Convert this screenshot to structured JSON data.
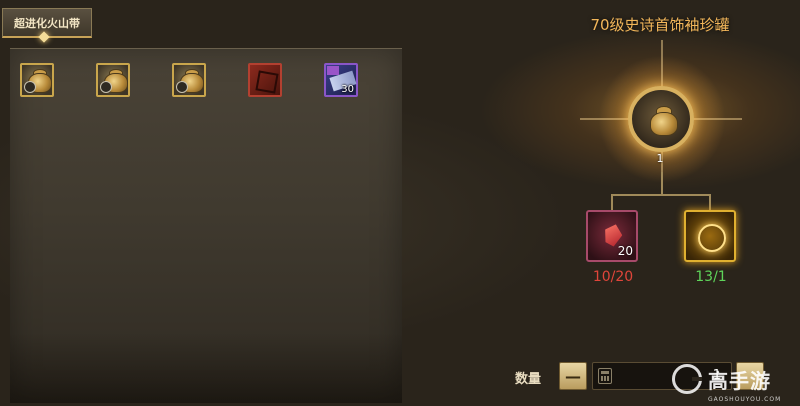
{
  "region": {
    "tab_label": "超进化火山带"
  },
  "inventory": {
    "items": [
      {
        "name": "珍罐",
        "rarity": "gold",
        "count": ""
      },
      {
        "name": "珍罐",
        "rarity": "gold",
        "count": ""
      },
      {
        "name": "珍罐",
        "rarity": "gold",
        "count": ""
      },
      {
        "name": "宝图",
        "rarity": "red",
        "count": ""
      },
      {
        "name": "票券",
        "rarity": "purple",
        "count": "30"
      }
    ]
  },
  "recipe": {
    "title": "70级史诗首饰袖珍罐",
    "result_count": "1",
    "materials": [
      {
        "icon": "crystal-icon",
        "qty": "20",
        "requirement": "10/20",
        "status_color": "#e0453a"
      },
      {
        "icon": "rune-icon",
        "qty": "",
        "requirement": "13/1",
        "status_color": "#5fd45a"
      }
    ]
  },
  "quantity": {
    "label": "数量",
    "minus_label": "—",
    "value": "1"
  },
  "watermark": {
    "text": "高手游",
    "sub": "GAOSHOUYOU.COM"
  },
  "colors": {
    "accent_gold": "#c9a64c",
    "title_orange": "#f2b65a",
    "insufficient_red": "#e0453a",
    "sufficient_green": "#5fd45a"
  }
}
